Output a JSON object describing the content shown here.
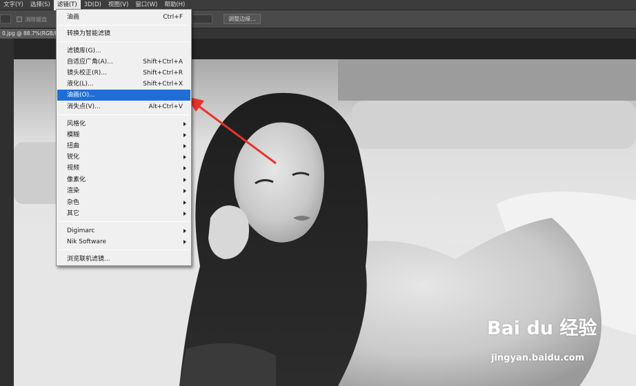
{
  "menubar": {
    "items": [
      {
        "label": "文字(Y)"
      },
      {
        "label": "选择(S)"
      },
      {
        "label": "滤镜(T)",
        "active": true
      },
      {
        "label": "3D(D)"
      },
      {
        "label": "视图(V)"
      },
      {
        "label": "窗口(W)"
      },
      {
        "label": "帮助(H)"
      }
    ]
  },
  "optionsbar": {
    "checkbox_label": "消除锯齿",
    "refine_button": "调整边缘..."
  },
  "document": {
    "tab_label": "0.jpg @ 88.7%(RGB/8"
  },
  "filter_menu": {
    "last_filter": {
      "label": "油画",
      "shortcut": "Ctrl+F"
    },
    "smart_filter": {
      "label": "转换为智能滤镜"
    },
    "filter_gallery": {
      "label": "滤镜库(G)..."
    },
    "adaptive_wide_angle": {
      "label": "自适应广角(A)...",
      "shortcut": "Shift+Ctrl+A"
    },
    "lens_correction": {
      "label": "镜头校正(R)...",
      "shortcut": "Shift+Ctrl+R"
    },
    "liquify": {
      "label": "液化(L)...",
      "shortcut": "Shift+Ctrl+X"
    },
    "oil_paint": {
      "label": "油画(O)...",
      "highlighted": true
    },
    "vanishing_point": {
      "label": "消失点(V)...",
      "shortcut": "Alt+Ctrl+V"
    },
    "submenus": [
      {
        "label": "风格化"
      },
      {
        "label": "模糊"
      },
      {
        "label": "扭曲"
      },
      {
        "label": "锐化"
      },
      {
        "label": "视频"
      },
      {
        "label": "像素化"
      },
      {
        "label": "渲染"
      },
      {
        "label": "杂色"
      },
      {
        "label": "其它"
      }
    ],
    "plugins": [
      {
        "label": "Digimarc"
      },
      {
        "label": "Nik Software"
      }
    ],
    "browse_online": {
      "label": "浏览联机滤镜..."
    }
  },
  "annotation": {
    "arrow_color": "#e8312a"
  },
  "watermark": {
    "logo": "Bai du 经验",
    "url": "jingyan.baidu.com"
  },
  "colors": {
    "highlight": "#1e6ed6",
    "menu_bg": "#f0f0f0",
    "menubar_bg": "#3c3c3c"
  }
}
